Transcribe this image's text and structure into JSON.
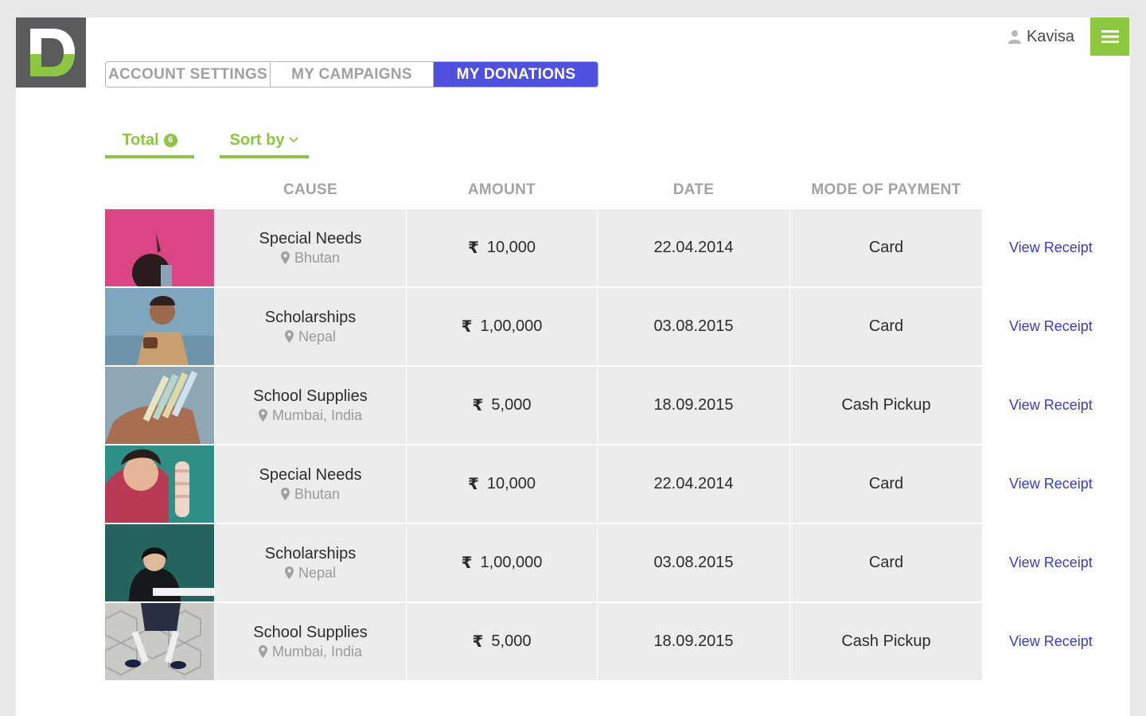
{
  "brand": {
    "logo_letter": "D",
    "accent": "#8dc63f",
    "primary": "#4f4fe0"
  },
  "user": {
    "name": "Kavisa",
    "icon": "user-icon"
  },
  "menu": {
    "icon": "hamburger-icon"
  },
  "tabs": [
    {
      "label": "ACCOUNT SETTINGS",
      "active": false
    },
    {
      "label": "MY CAMPAIGNS",
      "active": false
    },
    {
      "label": "MY DONATIONS",
      "active": true
    }
  ],
  "filters": {
    "total_label": "Total",
    "total_count": "6",
    "sort_label": "Sort by"
  },
  "table": {
    "headers": [
      "CAUSE",
      "AMOUNT",
      "DATE",
      "MODE OF PAYMENT"
    ],
    "currency_symbol": "₹",
    "receipt_label": "View Receipt",
    "rows": [
      {
        "cause": "Special Needs",
        "location": "Bhutan",
        "amount": "10,000",
        "date": "22.04.2014",
        "mode": "Card"
      },
      {
        "cause": "Scholarships",
        "location": "Nepal",
        "amount": "1,00,000",
        "date": "03.08.2015",
        "mode": "Card"
      },
      {
        "cause": "School Supplies",
        "location": "Mumbai, India",
        "amount": "5,000",
        "date": "18.09.2015",
        "mode": "Cash Pickup"
      },
      {
        "cause": "Special Needs",
        "location": "Bhutan",
        "amount": "10,000",
        "date": "22.04.2014",
        "mode": "Card"
      },
      {
        "cause": "Scholarships",
        "location": "Nepal",
        "amount": "1,00,000",
        "date": "03.08.2015",
        "mode": "Card"
      },
      {
        "cause": "School Supplies",
        "location": "Mumbai, India",
        "amount": "5,000",
        "date": "18.09.2015",
        "mode": "Cash Pickup"
      }
    ]
  }
}
